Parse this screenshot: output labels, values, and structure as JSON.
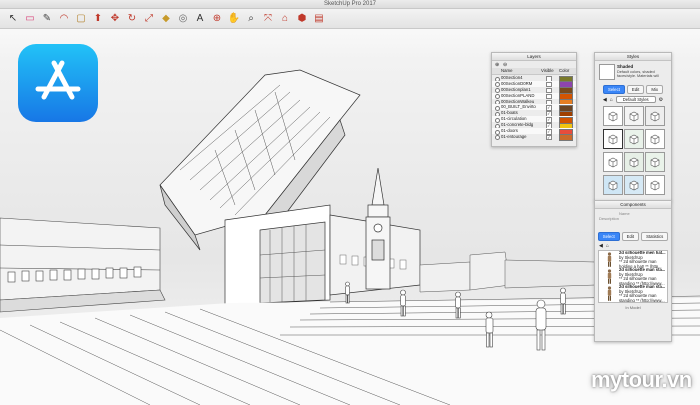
{
  "window": {
    "title": "SketchUp Pro 2017"
  },
  "toolbar": {
    "tools": [
      {
        "name": "select-tool-icon",
        "glyph": "↖",
        "color": "#333333"
      },
      {
        "name": "eraser-tool-icon",
        "glyph": "▭",
        "color": "#d9437a"
      },
      {
        "name": "line-tool-icon",
        "glyph": "✎",
        "color": "#444444"
      },
      {
        "name": "arc-tool-icon",
        "glyph": "◠",
        "color": "#c0392b"
      },
      {
        "name": "rectangle-tool-icon",
        "glyph": "▢",
        "color": "#b3832e"
      },
      {
        "name": "push-pull-tool-icon",
        "glyph": "⬆",
        "color": "#c0392b"
      },
      {
        "name": "move-tool-icon",
        "glyph": "✥",
        "color": "#c0392b"
      },
      {
        "name": "rotate-tool-icon",
        "glyph": "↻",
        "color": "#c0392b"
      },
      {
        "name": "scale-tool-icon",
        "glyph": "⤢",
        "color": "#c0392b"
      },
      {
        "name": "paint-bucket-icon",
        "glyph": "◆",
        "color": "#c79a2a"
      },
      {
        "name": "tape-measure-icon",
        "glyph": "◎",
        "color": "#6b6b6b"
      },
      {
        "name": "text-tool-icon",
        "glyph": "A",
        "color": "#333333"
      },
      {
        "name": "orbit-tool-icon",
        "glyph": "⊕",
        "color": "#c0392b"
      },
      {
        "name": "pan-tool-icon",
        "glyph": "✋",
        "color": "#2a7a2a"
      },
      {
        "name": "zoom-tool-icon",
        "glyph": "⌕",
        "color": "#333333"
      },
      {
        "name": "zoom-extents-icon",
        "glyph": "⤧",
        "color": "#c0392b"
      },
      {
        "name": "warehouse-icon",
        "glyph": "⌂",
        "color": "#c0392b"
      },
      {
        "name": "extension-warehouse-icon",
        "glyph": "⬢",
        "color": "#c0392b"
      },
      {
        "name": "send-to-layout-icon",
        "glyph": "▤",
        "color": "#c0392b"
      }
    ]
  },
  "layers_panel": {
    "title": "Layers",
    "columns": {
      "name": "Name",
      "visible": "Visible",
      "color": "Color"
    },
    "rows": [
      {
        "name": "00Section4",
        "visible": false,
        "color": "#7a7a2a"
      },
      {
        "name": "00SectionD0RM",
        "visible": false,
        "color": "#8e44ad"
      },
      {
        "name": "00Sectionplan1",
        "visible": false,
        "color": "#7a4a1a"
      },
      {
        "name": "00SectionPLAND",
        "visible": false,
        "color": "#d35400"
      },
      {
        "name": "00SectionWalkeu",
        "visible": false,
        "color": "#e67e22"
      },
      {
        "name": "00_BUILT_Envirto",
        "visible": true,
        "color": "#6b4423"
      },
      {
        "name": "01-boats",
        "visible": true,
        "color": "#a04000"
      },
      {
        "name": "01-circulation",
        "visible": true,
        "color": "#d35400"
      },
      {
        "name": "01-concrete-bldg",
        "visible": true,
        "color": "#f1c40f"
      },
      {
        "name": "01-doors",
        "visible": true,
        "color": "#e74c3c"
      },
      {
        "name": "01-entourage",
        "visible": true,
        "color": "#c96a2b"
      }
    ]
  },
  "styles_panel": {
    "title": "Styles",
    "style_name": "Shaded",
    "style_desc": "Default colors, shaded faces/style. Materials will",
    "tabs": [
      "Select",
      "Edit",
      "Mix"
    ],
    "selected_tab": "Select",
    "dropdown": "Default Styles",
    "selected_cell": 3
  },
  "components_panel": {
    "title": "Components",
    "name_placeholder": "Name",
    "desc_placeholder": "Description",
    "tabs": [
      "Select",
      "Edit",
      "Statistics"
    ],
    "selected_tab": "Select",
    "items": [
      {
        "line1": "2d silhouette men hat...",
        "line2": "by SketchUp",
        "line3": "** 2d silhouette man",
        "line4": "holding a hat! ** (http..."
      },
      {
        "line1": "2d silhouette man sta...",
        "line2": "by SketchUp",
        "line3": "** 2d silhouette man",
        "line4": "standing ** (http://www..."
      },
      {
        "line1": "2d silhouette man sta...",
        "line2": "by SketchUp",
        "line3": "** 2d silhouette man",
        "line4": "standing ** (http://www..."
      }
    ],
    "footer": "In Model"
  },
  "watermark": "mytour.vn",
  "colors": {
    "app_icon_top": "#22c2f7",
    "app_icon_bottom": "#1777e6",
    "select_blue": "#3a86f7"
  }
}
